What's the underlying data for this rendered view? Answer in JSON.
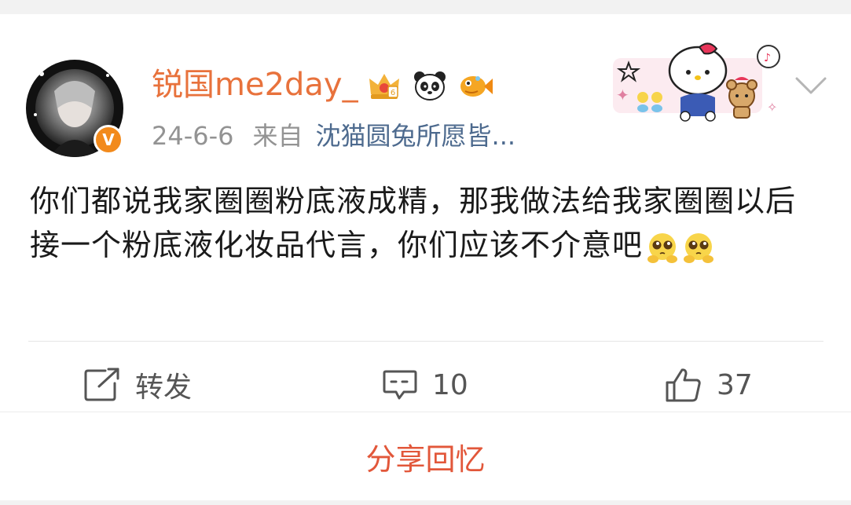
{
  "post": {
    "username": "锐国me2day_",
    "date": "24-6-6",
    "from_label": "来自",
    "source": "沈猫圆兔所愿皆...",
    "text": "你们都说我家圈圈粉底液成精，那我做法给我家圈圈以后接一个粉底液化妆品代言，你们应该不介意吧",
    "emojis": [
      "pleading-face-emoji",
      "pleading-face-emoji"
    ],
    "avatar_badge": "V"
  },
  "actions": {
    "repost_label": "转发",
    "comment_count": "10",
    "like_count": "37"
  },
  "share": {
    "label": "分享回忆"
  },
  "colors": {
    "username": "#e8723c",
    "source_link": "#4d6a8e",
    "share": "#e2573a",
    "badge": "#f28a1c"
  }
}
